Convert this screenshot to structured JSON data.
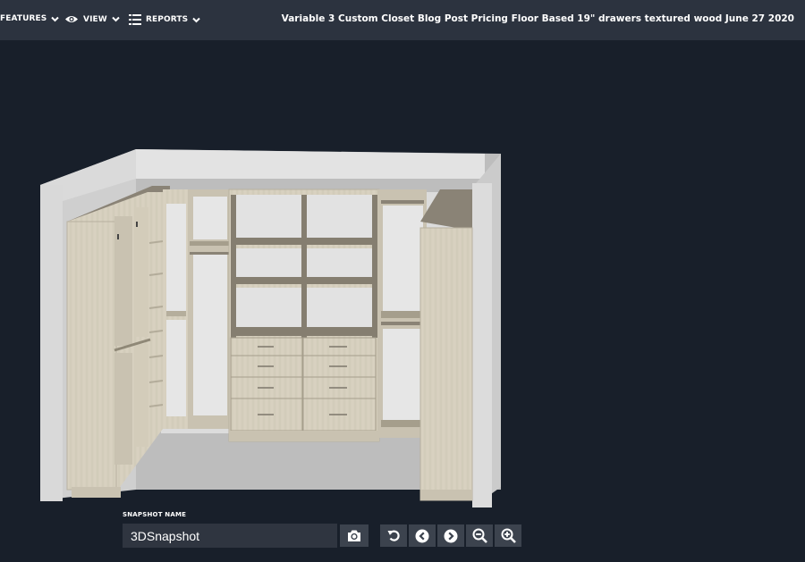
{
  "topbar": {
    "menus": [
      {
        "label": "FEATURES",
        "icon": "chevron-down-icon"
      },
      {
        "label": "VIEW",
        "icon": "eye-icon"
      },
      {
        "label": "REPORTS",
        "icon": "list-icon"
      }
    ],
    "project_title": "Variable 3 Custom Closet Blog Post Pricing Floor Based 19\" drawers textured wood June 27 2020"
  },
  "snapshot": {
    "label": "SNAPSHOT NAME",
    "value": "3DSnapshot"
  },
  "controls": [
    {
      "icon": "camera-icon"
    },
    {
      "icon": "rotate-icon"
    },
    {
      "icon": "chevron-left-icon"
    },
    {
      "icon": "chevron-right-icon"
    },
    {
      "icon": "zoom-out-icon"
    },
    {
      "icon": "zoom-in-icon"
    }
  ],
  "colors": {
    "background": "#181f2a",
    "topbar": "#2c333f",
    "wood": "#d6cfbe",
    "wall": "#c8c8c8"
  }
}
